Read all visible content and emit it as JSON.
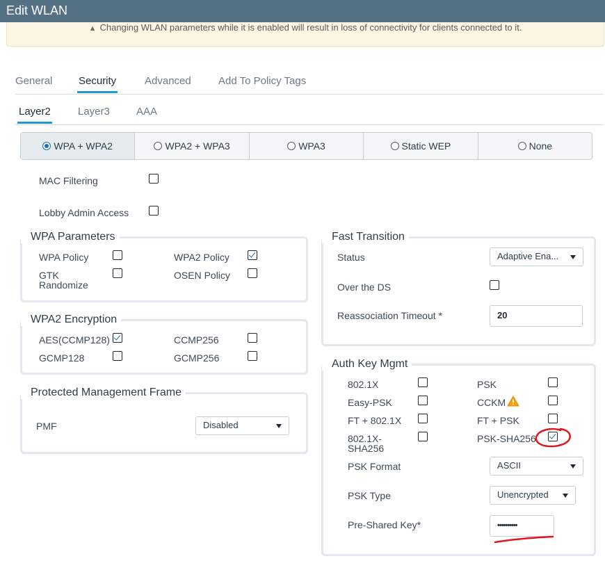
{
  "window": {
    "title": "Edit WLAN"
  },
  "banner": {
    "text": "Changing WLAN parameters while it is enabled will result in loss of connectivity for clients connected to it."
  },
  "tabs": [
    "General",
    "Security",
    "Advanced",
    "Add To Policy Tags"
  ],
  "subtabs": [
    "Layer2",
    "Layer3",
    "AAA"
  ],
  "security_modes": [
    "WPA + WPA2",
    "WPA2 + WPA3",
    "WPA3",
    "Static WEP",
    "None"
  ],
  "selected_mode": "WPA + WPA2",
  "general_options": {
    "mac_filtering": {
      "label": "MAC Filtering",
      "checked": false
    },
    "lobby_admin": {
      "label": "Lobby Admin Access",
      "checked": false
    }
  },
  "wpa_params": {
    "title": "WPA Parameters",
    "wpa_policy": {
      "label": "WPA Policy",
      "checked": false
    },
    "wpa2_policy": {
      "label": "WPA2 Policy",
      "checked": true
    },
    "gtk_randomize": {
      "label_line1": "GTK",
      "label_line2": "Randomize",
      "checked": false
    },
    "osen_policy": {
      "label": "OSEN Policy",
      "checked": false
    }
  },
  "wpa2_encryption": {
    "title": "WPA2 Encryption",
    "aes": {
      "label": "AES(CCMP128)",
      "checked": true
    },
    "ccmp256": {
      "label": "CCMP256",
      "checked": false
    },
    "gcmp128": {
      "label": "GCMP128",
      "checked": false
    },
    "gcmp256": {
      "label": "GCMP256",
      "checked": false
    }
  },
  "pmf": {
    "title": "Protected Management Frame",
    "label": "PMF",
    "value": "Disabled"
  },
  "fast_transition": {
    "title": "Fast Transition",
    "status_label": "Status",
    "status_value": "Adaptive Ena...",
    "over_ds_label": "Over the DS",
    "over_ds_checked": false,
    "reassoc_label": "Reassociation Timeout *",
    "reassoc_value": "20"
  },
  "auth_key_mgmt": {
    "title": "Auth Key Mgmt",
    "dot1x": {
      "label": "802.1X",
      "checked": false
    },
    "psk": {
      "label": "PSK",
      "checked": false
    },
    "easy_psk": {
      "label": "Easy-PSK",
      "checked": false
    },
    "cckm": {
      "label": "CCKM",
      "checked": false
    },
    "ft_dot1x": {
      "label": "FT + 802.1X",
      "checked": false
    },
    "ft_psk": {
      "label": "FT + PSK",
      "checked": false
    },
    "dot1x_sha256": {
      "label_line1": "802.1X-",
      "label_line2": "SHA256",
      "checked": false
    },
    "psk_sha256": {
      "label": "PSK-SHA256",
      "checked": true
    },
    "psk_format_label": "PSK Format",
    "psk_format_value": "ASCII",
    "psk_type_label": "PSK Type",
    "psk_type_value": "Unencrypted",
    "psk_key_label": "Pre-Shared Key*",
    "psk_key_value": "••••••••••"
  },
  "colors": {
    "titlebar": "#557184",
    "accent": "#1a9bd7",
    "annotation": "#e0161c",
    "warning": "#f0a30a"
  }
}
